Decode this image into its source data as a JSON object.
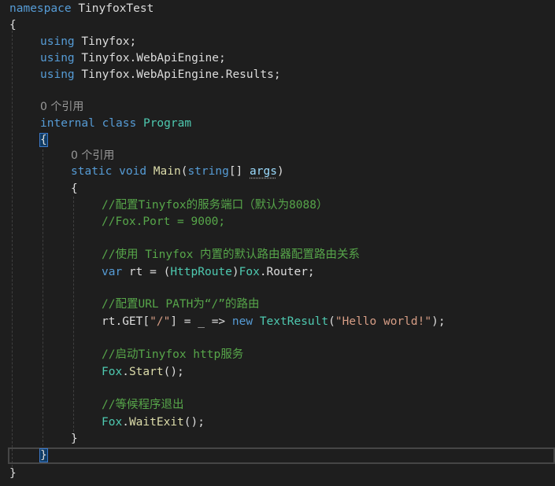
{
  "code": {
    "namespace_kw": "namespace",
    "namespace_name": "TinyfoxTest",
    "open_brace": "{",
    "close_brace": "}",
    "using_kw": "using",
    "usings": [
      "Tinyfox;",
      "Tinyfox.WebApiEngine;",
      "Tinyfox.WebApiEngine.Results;"
    ],
    "class_codelens": "0 个引用",
    "internal_kw": "internal",
    "class_kw": "class",
    "class_name": "Program",
    "method_codelens": "0 个引用",
    "static_kw": "static",
    "void_kw": "void",
    "method_name": "Main",
    "param_type": "string",
    "param_brackets": "[] ",
    "param_name": "args",
    "paren_open": "(",
    "paren_close": ")",
    "comment1": "//配置Tinyfox的服务端口（默认为8088）",
    "comment2": "//Fox.Port = 9000;",
    "comment3": "//使用 Tinyfox 内置的默认路由器配置路由关系",
    "var_kw": "var",
    "line_rt_1": " rt = (",
    "http_route": "HttpRoute",
    "line_rt_2": ")",
    "fox": "Fox",
    "router_tail": ".Router;",
    "comment4": "//配置URL PATH为“/”的路由",
    "rt_get_1": "rt.GET[",
    "route_str": "\"/\"",
    "rt_get_2": "] = _ => ",
    "new_kw": "new",
    "text_result": "TextResult",
    "hello_str": "\"Hello world!\"",
    "rt_get_3": ");",
    "comment5": "//启动Tinyfox http服务",
    "start_fn": "Start",
    "call_tail": "();",
    "comment6": "//等候程序退出",
    "waitexit_fn": "WaitExit",
    "dot": ".",
    "space": " "
  }
}
